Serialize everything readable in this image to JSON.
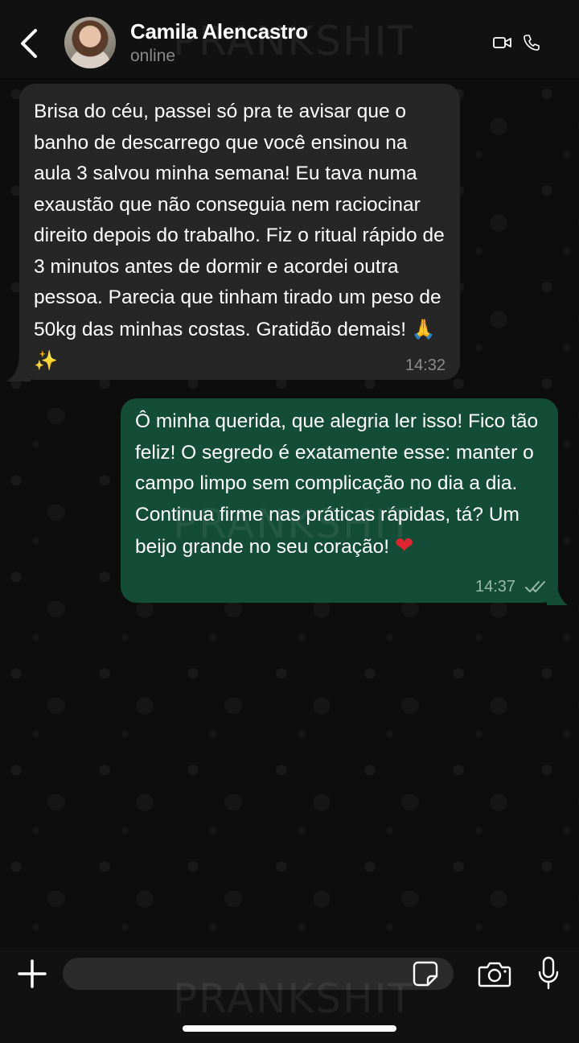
{
  "header": {
    "contact_name": "Camila Alencastro",
    "status": "online",
    "back_icon": "chevron-left-icon",
    "video_icon": "video-camera-icon",
    "phone_icon": "phone-icon"
  },
  "watermark": "PRANKSHIT",
  "messages": [
    {
      "direction": "incoming",
      "text": "Brisa do céu, passei só pra te avisar que o banho de descarrego que você ensinou na aula 3 salvou minha semana! Eu tava numa exaustão que não conseguia nem raciocinar direito depois do trabalho. Fiz o ritual rápido de 3 minutos antes de dormir e acordei outra pessoa. Parecia que tinham tirado um peso de 50kg das minhas costas. Gratidão demais!",
      "emojis": "🙏 ✨",
      "time": "14:32"
    },
    {
      "direction": "outgoing",
      "text": "Ô minha querida, que alegria ler isso! Fico tão feliz! O segredo é exatamente esse: manter o campo limpo sem complicação no dia a dia. Continua firme nas práticas rápidas, tá? Um beijo grande no seu coração!",
      "emojis": "❤",
      "time": "14:37",
      "status": "read"
    }
  ],
  "composer": {
    "input_value": "",
    "input_placeholder": "",
    "plus_icon": "plus-icon",
    "sticker_icon": "sticker-icon",
    "camera_icon": "camera-icon",
    "mic_icon": "microphone-icon"
  },
  "colors": {
    "incoming_bubble": "#262626",
    "outgoing_bubble": "#144d37",
    "background": "#0b0b0b",
    "bar": "#111111"
  }
}
